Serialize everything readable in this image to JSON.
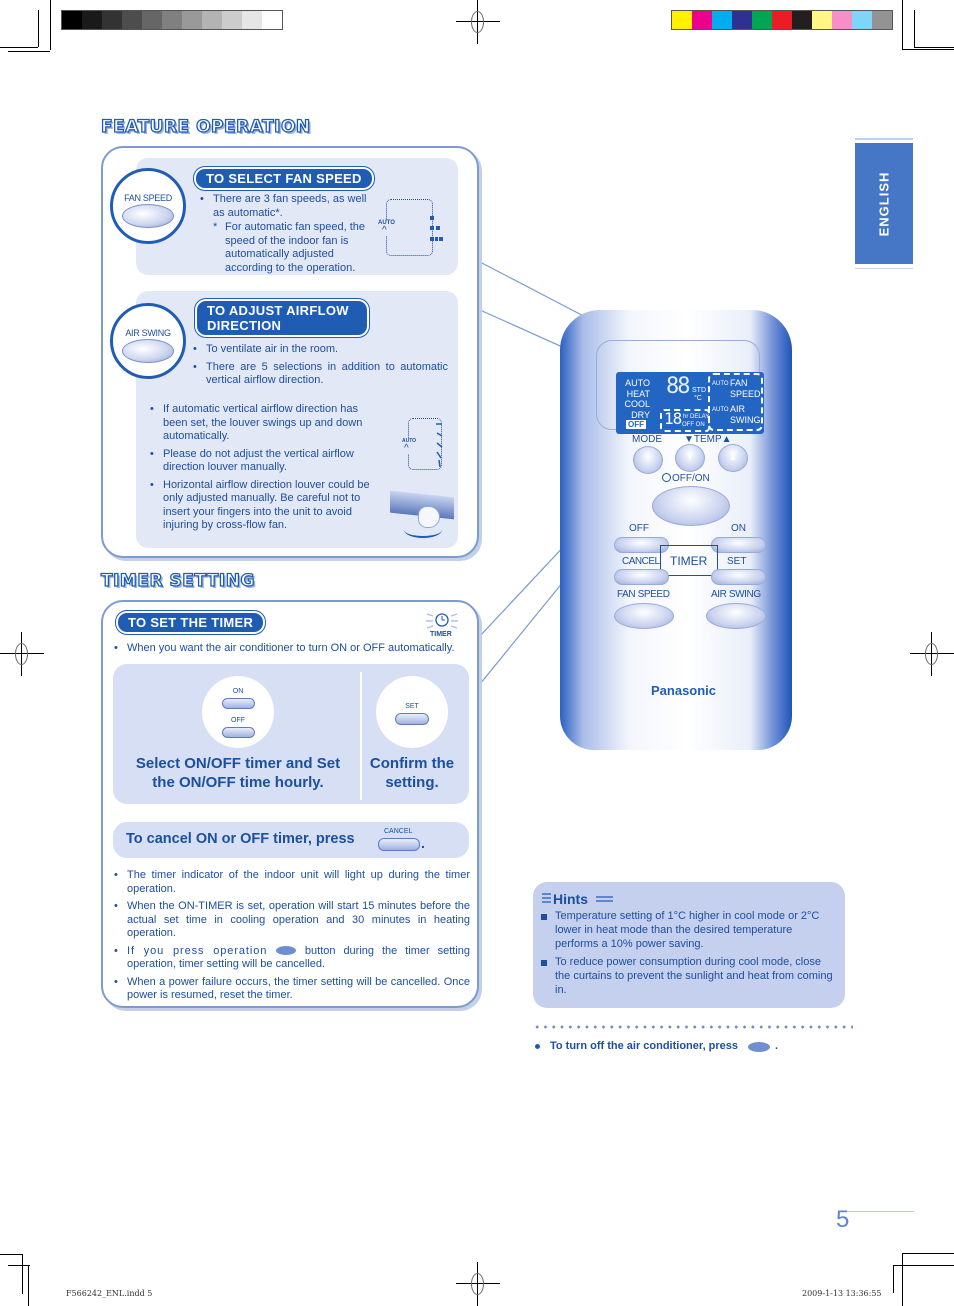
{
  "print_marks": {
    "grayscale_swatches": [
      "#000000",
      "#1a1a1a",
      "#333333",
      "#4d4d4d",
      "#666666",
      "#808080",
      "#999999",
      "#b3b3b3",
      "#cccccc",
      "#e6e6e6",
      "#ffffff"
    ],
    "color_swatches": [
      "#fff100",
      "#ec008c",
      "#00aeef",
      "#2e3192",
      "#00a651",
      "#ed1c24",
      "#231f20",
      "#fff685",
      "#f68fc8",
      "#7dd6f7",
      "#939393"
    ],
    "footer_file": "F566242_ENL.indd   5",
    "footer_timestamp": "2009-1-13   13:36:55"
  },
  "side_tab": {
    "label": "ENGLISH",
    "color": "#4577c6"
  },
  "page_number": "5",
  "feature_operation": {
    "heading": "FEATURE OPERATION",
    "fan_speed": {
      "button_label": "FAN SPEED",
      "pill": "TO SELECT FAN SPEED",
      "bullet": "There are 3 fan speeds, as well as automatic*.",
      "note_mark": "*",
      "note": "For automatic fan speed, the speed of the indoor fan is automatically adjusted according to the operation.",
      "diagram_auto": "AUTO",
      "diagram_arrow": "^"
    },
    "air_swing": {
      "button_label": "AIR SWING",
      "pill": "TO ADJUST AIRFLOW DIRECTION",
      "bullets_top": [
        "To ventilate air in the room.",
        "There are 5 selections in addition to automatic vertical airflow direction."
      ],
      "bullets_bottom": [
        "If automatic vertical airflow direction has been set, the louver swings up and down automatically.",
        "Please do not adjust the vertical airflow direction louver manually.",
        "Horizontal airflow direction louver could be only adjusted manually. Be careful not to insert your fingers into the unit to avoid injuring by cross-flow fan."
      ],
      "diagram_auto": "AUTO",
      "diagram_arrow": "^"
    }
  },
  "timer_setting": {
    "heading": "TIMER SETTING",
    "pill": "TO SET THE TIMER",
    "timer_icon_label": "TIMER",
    "intro": "When you want the air conditioner to turn ON or OFF automatically.",
    "step1": {
      "btn_on": "ON",
      "btn_off": "OFF",
      "caption": "Select ON/OFF timer and Set the ON/OFF time hourly."
    },
    "step2": {
      "btn_set": "SET",
      "caption": "Confirm the setting."
    },
    "cancel_text": "To cancel ON or OFF timer, press",
    "cancel_button": "CANCEL",
    "cancel_period": ".",
    "notes": [
      "The timer indicator of the indoor unit will light up during the timer operation.",
      "When the ON-TIMER is set, operation will start 15 minutes before the actual set time in cooling operation and 30 minutes in heating operation.",
      "If you press operation",
      "button during the timer setting operation, timer setting will be cancelled.",
      "When a power failure occurs, the timer setting will be cancelled. Once power is resumed, reset the timer."
    ]
  },
  "remote": {
    "lcd_modes": [
      "AUTO",
      "HEAT",
      "COOL",
      "DRY"
    ],
    "lcd_off": "OFF",
    "lcd_temp_digits": "88",
    "lcd_std": "STD",
    "lcd_unit": "°C",
    "lcd_timer_digits": "18",
    "lcd_hr": "hr",
    "lcd_delay": "DELAY",
    "lcd_offon": "OFF ON",
    "lcd_fan_auto": "AUTO",
    "lcd_swing_auto": "AUTO",
    "lcd_fan_label": "FAN SPEED",
    "lcd_swing_label": "AIR SWING",
    "mode_label": "MODE",
    "temp_label": "▼TEMP▲",
    "offon_label": "OFF/ON",
    "timer_off": "OFF",
    "timer_on": "ON",
    "cancel": "CANCEL",
    "timer": "TIMER",
    "set": "SET",
    "fan_speed": "FAN SPEED",
    "air_swing": "AIR SWING",
    "brand": "Panasonic",
    "down_arrow": "▼",
    "up_arrow": "▲"
  },
  "hints": {
    "title": "Hints",
    "items": [
      "Temperature setting of 1°C higher in cool mode or 2°C lower in heat mode than the desired temperature performs a 10% power saving.",
      "To reduce power consumption during cool mode, close the curtains to prevent the sunlight and heat from coming in."
    ]
  },
  "turn_off": {
    "text": "To turn off the air conditioner, press",
    "period": "."
  }
}
